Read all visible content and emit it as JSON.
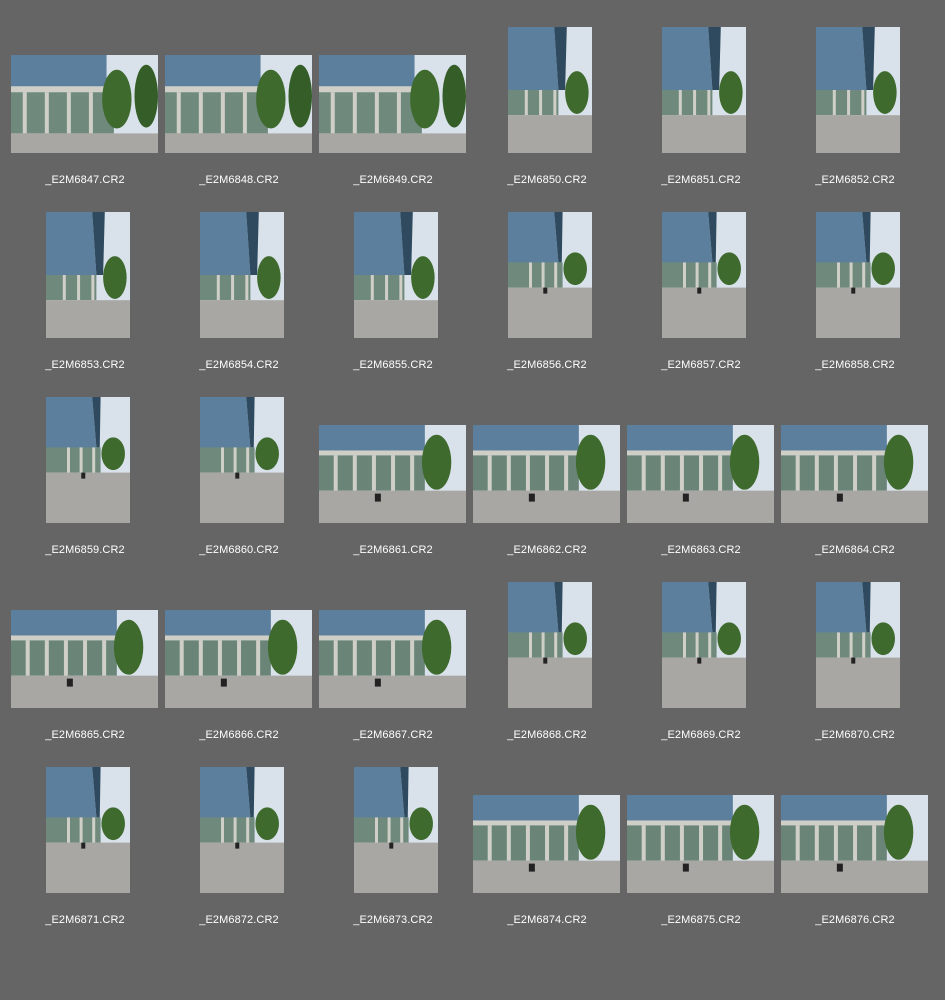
{
  "browser": {
    "thumbnails": [
      {
        "filename": "_E2M6847.CR2",
        "orientation": "landscape",
        "scene": "building-close"
      },
      {
        "filename": "_E2M6848.CR2",
        "orientation": "landscape",
        "scene": "building-close"
      },
      {
        "filename": "_E2M6849.CR2",
        "orientation": "landscape",
        "scene": "building-close"
      },
      {
        "filename": "_E2M6850.CR2",
        "orientation": "portrait",
        "scene": "tower-tree"
      },
      {
        "filename": "_E2M6851.CR2",
        "orientation": "portrait",
        "scene": "tower-tree"
      },
      {
        "filename": "_E2M6852.CR2",
        "orientation": "portrait",
        "scene": "tower-tree"
      },
      {
        "filename": "_E2M6853.CR2",
        "orientation": "portrait",
        "scene": "tower-tree"
      },
      {
        "filename": "_E2M6854.CR2",
        "orientation": "portrait",
        "scene": "tower-tree"
      },
      {
        "filename": "_E2M6855.CR2",
        "orientation": "portrait",
        "scene": "tower-tree"
      },
      {
        "filename": "_E2M6856.CR2",
        "orientation": "portrait",
        "scene": "plaza-tower"
      },
      {
        "filename": "_E2M6857.CR2",
        "orientation": "portrait",
        "scene": "plaza-tower"
      },
      {
        "filename": "_E2M6858.CR2",
        "orientation": "portrait",
        "scene": "plaza-tower"
      },
      {
        "filename": "_E2M6859.CR2",
        "orientation": "portrait",
        "scene": "plaza-tower"
      },
      {
        "filename": "_E2M6860.CR2",
        "orientation": "portrait",
        "scene": "plaza-tower"
      },
      {
        "filename": "_E2M6861.CR2",
        "orientation": "landscape",
        "scene": "plaza-wide"
      },
      {
        "filename": "_E2M6862.CR2",
        "orientation": "landscape",
        "scene": "plaza-wide"
      },
      {
        "filename": "_E2M6863.CR2",
        "orientation": "landscape",
        "scene": "plaza-wide"
      },
      {
        "filename": "_E2M6864.CR2",
        "orientation": "landscape",
        "scene": "plaza-wide"
      },
      {
        "filename": "_E2M6865.CR2",
        "orientation": "landscape",
        "scene": "plaza-wide"
      },
      {
        "filename": "_E2M6866.CR2",
        "orientation": "landscape",
        "scene": "plaza-wide"
      },
      {
        "filename": "_E2M6867.CR2",
        "orientation": "landscape",
        "scene": "plaza-wide"
      },
      {
        "filename": "_E2M6868.CR2",
        "orientation": "portrait",
        "scene": "plaza-tower"
      },
      {
        "filename": "_E2M6869.CR2",
        "orientation": "portrait",
        "scene": "plaza-tower"
      },
      {
        "filename": "_E2M6870.CR2",
        "orientation": "portrait",
        "scene": "plaza-tower"
      },
      {
        "filename": "_E2M6871.CR2",
        "orientation": "portrait",
        "scene": "plaza-tower"
      },
      {
        "filename": "_E2M6872.CR2",
        "orientation": "portrait",
        "scene": "plaza-tower"
      },
      {
        "filename": "_E2M6873.CR2",
        "orientation": "portrait",
        "scene": "plaza-tower"
      },
      {
        "filename": "_E2M6874.CR2",
        "orientation": "landscape",
        "scene": "plaza-wide"
      },
      {
        "filename": "_E2M6875.CR2",
        "orientation": "landscape",
        "scene": "plaza-wide"
      },
      {
        "filename": "_E2M6876.CR2",
        "orientation": "landscape",
        "scene": "plaza-wide"
      }
    ]
  },
  "colors": {
    "background": "#656565",
    "label": "#ffffff",
    "sky": "#d9e2ea",
    "glass": "#5b7f9c",
    "glass_dark": "#2f4a5e",
    "pillar": "#cfcfc8",
    "tree": "#3f6a2e",
    "pavement": "#a9a7a3"
  }
}
